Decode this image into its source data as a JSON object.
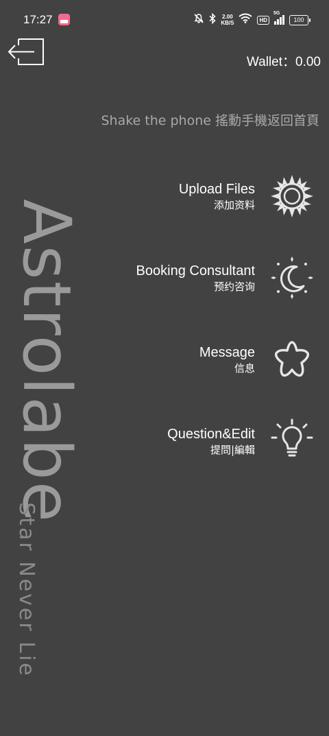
{
  "status_bar": {
    "time": "17:27",
    "net_speed_value": "2.00",
    "net_speed_unit": "KB/S",
    "hd_label": "HD",
    "network_type": "5G",
    "battery": "100"
  },
  "header": {
    "wallet": "Wallet：0.00"
  },
  "hint": "Shake the phone 搖動手機返回首頁",
  "menu": {
    "items": [
      {
        "title": "Upload Files",
        "subtitle": "添加资料",
        "icon": "sun-icon"
      },
      {
        "title": "Booking Consultant",
        "subtitle": "预约咨询",
        "icon": "moon-stars-icon"
      },
      {
        "title": "Message",
        "subtitle": "信息",
        "icon": "star-icon"
      },
      {
        "title": "Question&Edit",
        "subtitle": "提問|編輯",
        "icon": "lightbulb-icon"
      }
    ]
  },
  "brand": {
    "title": "Astrolabe",
    "tagline": "Star Never Lie"
  },
  "colors": {
    "background": "#424242",
    "brand_text": "#9a9a9a",
    "hint_text": "#a9a9a9"
  }
}
